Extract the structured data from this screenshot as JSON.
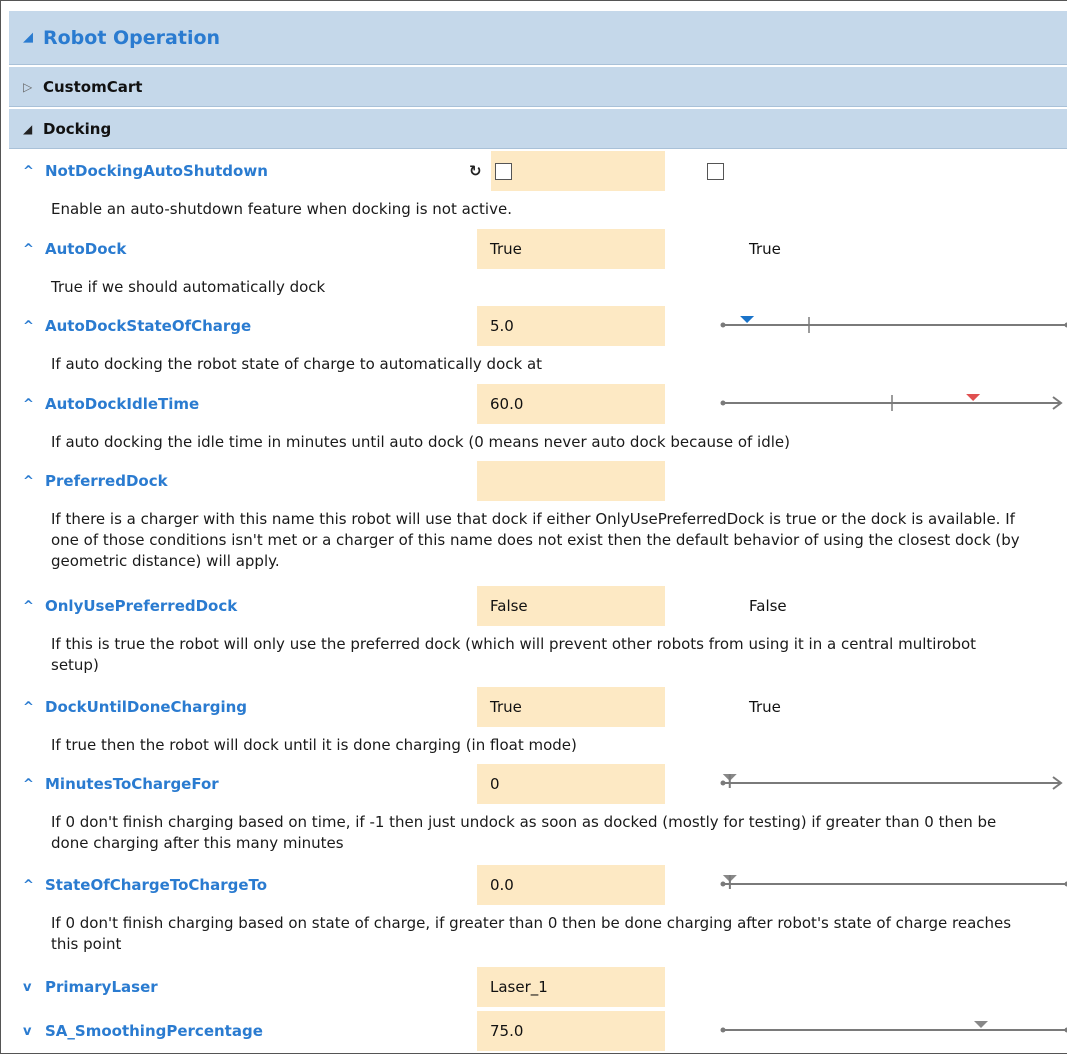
{
  "header": {
    "title": "Robot Operation"
  },
  "groups": {
    "custom_cart": "CustomCart",
    "docking": "Docking"
  },
  "properties": [
    {
      "name": "NotDockingAutoShutdown",
      "value": "",
      "default": "",
      "description": "Enable an auto-shutdown feature when docking is not active.",
      "type": "checkbox",
      "checked": false,
      "default_checked": false
    },
    {
      "name": "AutoDock",
      "value": "True",
      "default": "True",
      "description": "True if we should automatically dock"
    },
    {
      "name": "AutoDockStateOfCharge",
      "value": "5.0",
      "description": "If auto docking the robot state of charge to automatically dock at",
      "slider": {
        "value_marker_color": "#1a73c9",
        "value_fraction": 0.07,
        "tick_fraction": 0.25,
        "arrow": false
      }
    },
    {
      "name": "AutoDockIdleTime",
      "value": "60.0",
      "description": "If auto docking the idle time in minutes until auto dock (0 means never auto dock because of idle)",
      "slider": {
        "value_marker_color": "#e05050",
        "value_fraction": 0.74,
        "tick_fraction": 0.5,
        "arrow": true
      }
    },
    {
      "name": "PreferredDock",
      "value": "",
      "description": "If there is a charger with this name this robot will use that dock if either OnlyUsePreferredDock is true or the dock is available. If one of those conditions isn't met or a charger of this name does not exist then the default behavior of using the closest dock (by geometric distance) will apply."
    },
    {
      "name": "OnlyUsePreferredDock",
      "value": "False",
      "default": "False",
      "description": "If this is true the robot will only use the preferred dock (which will prevent other robots from using it in a central multirobot setup)"
    },
    {
      "name": "DockUntilDoneCharging",
      "value": "True",
      "default": "True",
      "description": "If true then the robot will dock until it is done charging (in float mode)"
    },
    {
      "name": "MinutesToChargeFor",
      "value": "0",
      "description": "If 0 don't finish charging based on time, if -1 then just undock as soon as docked (mostly for testing) if greater than 0 then be done charging after this many minutes",
      "slider": {
        "value_marker_color": "#888888",
        "value_fraction": 0.02,
        "arrow": true
      }
    },
    {
      "name": "StateOfChargeToChargeTo",
      "value": "0.0",
      "description": "If 0 don't finish charging based on state of charge, if greater than 0 then be done charging after robot's state of charge reaches this point",
      "slider": {
        "value_marker_color": "#888888",
        "value_fraction": 0.02,
        "arrow": false
      }
    },
    {
      "name": "PrimaryLaser",
      "value": "Laser_1",
      "collapsed": true
    },
    {
      "name": "SA_SmoothingPercentage",
      "value": "75.0",
      "collapsed": true,
      "slider": {
        "value_marker_color": "#888888",
        "value_fraction": 0.75,
        "arrow": false
      }
    }
  ],
  "icons": {
    "expanded": "triangle-down-icon",
    "collapsed": "triangle-right-icon",
    "property_expanded": "chevron-up-icon",
    "property_collapsed": "chevron-down-icon",
    "reset": "reset-icon"
  }
}
